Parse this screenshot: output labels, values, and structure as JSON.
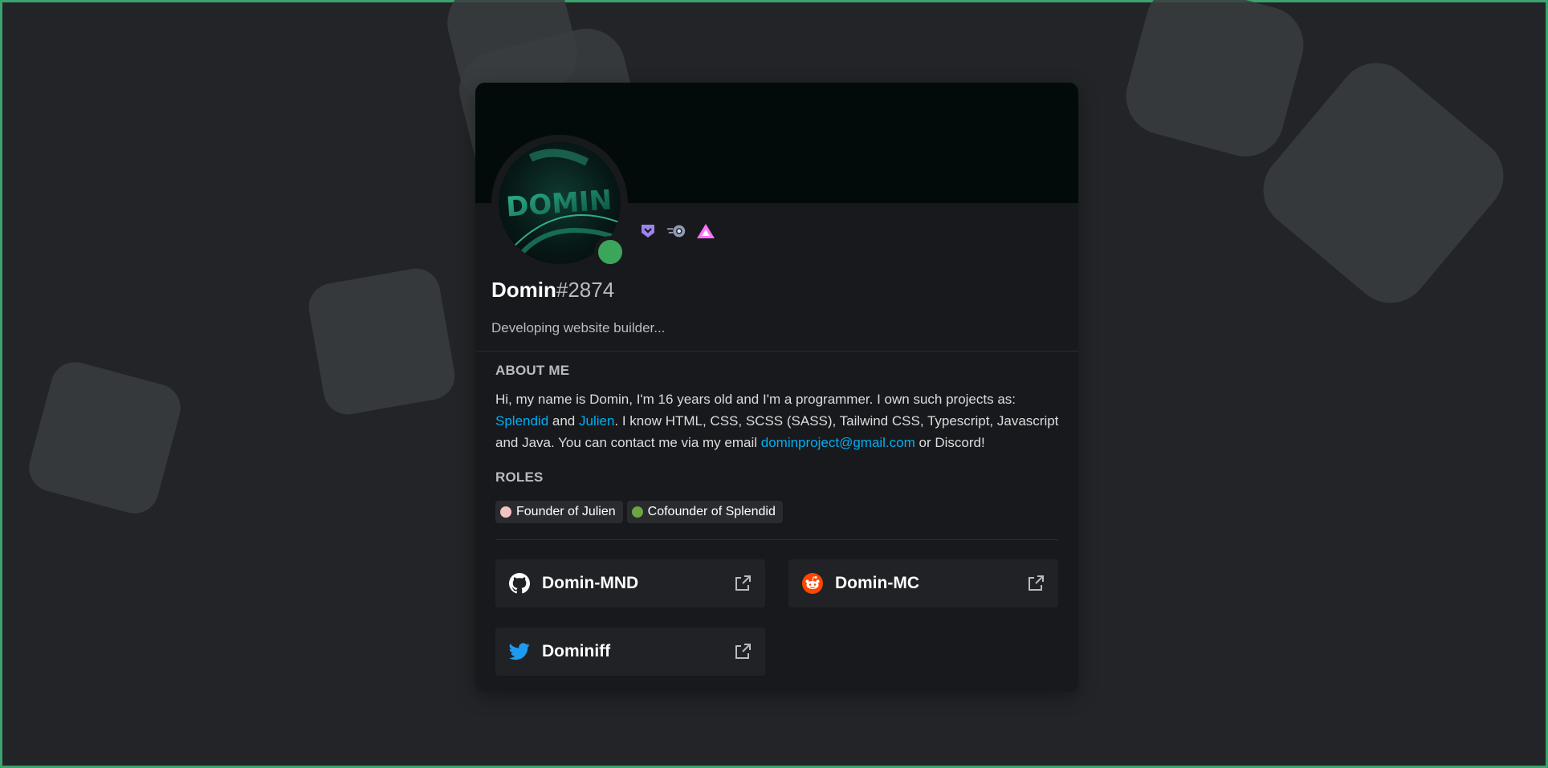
{
  "profile": {
    "username": "Domin",
    "discriminator": "#2874",
    "custom_status": "Developing website builder...",
    "avatar_text": "DOMIN",
    "status": "online",
    "status_color": "#3ba55c",
    "badges": [
      {
        "icon": "hypesquad-balance-icon",
        "color": "#9b84ec"
      },
      {
        "icon": "nitro-boost-icon",
        "color": "#8f9bb3"
      },
      {
        "icon": "early-supporter-icon",
        "color": "#ff73fa"
      }
    ]
  },
  "about": {
    "title": "ABOUT ME",
    "p1": "Hi, my name is Domin, I'm 16 years old and I'm a programmer. I own such projects as: ",
    "link1": "Splendid",
    "p2": " and ",
    "link2": "Julien",
    "p3": ". I know HTML, CSS, SCSS (SASS), Tailwind CSS, Typescript, Javascript and Java. You can contact me via my email ",
    "email": "dominproject@gmail.com",
    "p4": " or Discord!"
  },
  "roles": {
    "title": "ROLES",
    "items": [
      {
        "label": "Founder of Julien",
        "color": "#f4c2c2"
      },
      {
        "label": "Cofounder of Splendid",
        "color": "#6da544"
      }
    ]
  },
  "connections": [
    {
      "icon": "github-icon",
      "name": "Domin-MND"
    },
    {
      "icon": "reddit-icon",
      "name": "Domin-MC"
    },
    {
      "icon": "twitter-icon",
      "name": "Dominiff"
    }
  ],
  "colors": {
    "background": "#222427",
    "card": "#18191c",
    "accent_link": "#00aff4",
    "frame": "#3ba46c"
  }
}
